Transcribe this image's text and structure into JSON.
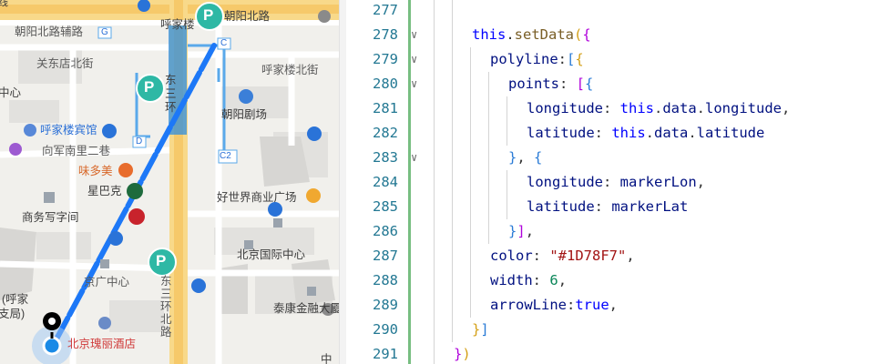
{
  "map": {
    "labels": {
      "chaoyang_north_rd_top": "朝阳北路",
      "huhudajie_short": "呼家楼",
      "road_top_left": "线",
      "chaoyang_north_aux": "朝阳北路辅路",
      "guandongdian_north": "关东店北街",
      "zhong": "中心",
      "hujialou_north_st": "呼家楼北街",
      "east_third_ring_a": "东",
      "east_third_ring_b": "三",
      "east_third_ring_c": "环",
      "chaoyang_theater": "朝阳剧场",
      "hujialou_hotel": "呼家楼宾馆",
      "xiangjun_south": "向军南里二巷",
      "weiduomei": "味多美",
      "starbucks": "星巴克",
      "shangwu": "商务写字间",
      "haoshijie": "好世界商业广场",
      "beijing_intl_center": "北京国际中心",
      "jingguang_center": "京广中心",
      "taikang": "泰康金融大厦",
      "hujia_branch_a": "(呼家",
      "hujia_branch_b": "支局)",
      "beijing_guili": "北京瑰丽酒店",
      "east3rd_north_a": "东",
      "east3rd_north_b": "三",
      "east3rd_north_c": "环",
      "east3rd_north_d": "北",
      "east3rd_north_e": "路",
      "exit_c": "C",
      "exit_c2": "C2",
      "exit_d": "D",
      "exit_g": "G",
      "parking": "P",
      "zhong_bottom": "中"
    },
    "route_color": "#1D78F7"
  },
  "editor": {
    "lines": [
      {
        "num": "277",
        "fold": "",
        "indent": 2,
        "tokens": []
      },
      {
        "num": "278",
        "fold": "∨",
        "indent": 2,
        "tokens": [
          {
            "t": "this",
            "c": "k-this"
          },
          {
            "t": ".",
            "c": "k-pun"
          },
          {
            "t": "setData",
            "c": "k-fn"
          },
          {
            "t": "(",
            "c": "k-b1"
          },
          {
            "t": "{",
            "c": "k-b2"
          }
        ]
      },
      {
        "num": "279",
        "fold": "∨",
        "indent": 3,
        "tokens": [
          {
            "t": "polyline",
            "c": "k-var"
          },
          {
            "t": ":",
            "c": "k-pun"
          },
          {
            "t": "[",
            "c": "k-b3"
          },
          {
            "t": "{",
            "c": "k-b1"
          }
        ]
      },
      {
        "num": "280",
        "fold": "∨",
        "indent": 4,
        "tokens": [
          {
            "t": "points",
            "c": "k-var"
          },
          {
            "t": ": ",
            "c": "k-pun"
          },
          {
            "t": "[",
            "c": "k-b2"
          },
          {
            "t": "{",
            "c": "k-b3"
          }
        ]
      },
      {
        "num": "281",
        "fold": "",
        "indent": 5,
        "tokens": [
          {
            "t": "longitude",
            "c": "k-var"
          },
          {
            "t": ": ",
            "c": "k-pun"
          },
          {
            "t": "this",
            "c": "k-this"
          },
          {
            "t": ".",
            "c": "k-pun"
          },
          {
            "t": "data",
            "c": "k-var"
          },
          {
            "t": ".",
            "c": "k-pun"
          },
          {
            "t": "longitude",
            "c": "k-var"
          },
          {
            "t": ",",
            "c": "k-pun"
          }
        ]
      },
      {
        "num": "282",
        "fold": "",
        "indent": 5,
        "tokens": [
          {
            "t": "latitude",
            "c": "k-var"
          },
          {
            "t": ": ",
            "c": "k-pun"
          },
          {
            "t": "this",
            "c": "k-this"
          },
          {
            "t": ".",
            "c": "k-pun"
          },
          {
            "t": "data",
            "c": "k-var"
          },
          {
            "t": ".",
            "c": "k-pun"
          },
          {
            "t": "latitude",
            "c": "k-var"
          }
        ]
      },
      {
        "num": "283",
        "fold": "∨",
        "indent": 4,
        "tokens": [
          {
            "t": "}",
            "c": "k-b3"
          },
          {
            "t": ", ",
            "c": "k-pun"
          },
          {
            "t": "{",
            "c": "k-b3"
          }
        ]
      },
      {
        "num": "284",
        "fold": "",
        "indent": 5,
        "tokens": [
          {
            "t": "longitude",
            "c": "k-var"
          },
          {
            "t": ": ",
            "c": "k-pun"
          },
          {
            "t": "markerLon",
            "c": "k-var"
          },
          {
            "t": ",",
            "c": "k-pun"
          }
        ]
      },
      {
        "num": "285",
        "fold": "",
        "indent": 5,
        "tokens": [
          {
            "t": "latitude",
            "c": "k-var"
          },
          {
            "t": ": ",
            "c": "k-pun"
          },
          {
            "t": "markerLat",
            "c": "k-var"
          }
        ]
      },
      {
        "num": "286",
        "fold": "",
        "indent": 4,
        "tokens": [
          {
            "t": "}",
            "c": "k-b3"
          },
          {
            "t": "]",
            "c": "k-b2"
          },
          {
            "t": ",",
            "c": "k-pun"
          }
        ]
      },
      {
        "num": "287",
        "fold": "",
        "indent": 3,
        "tokens": [
          {
            "t": "color",
            "c": "k-var"
          },
          {
            "t": ": ",
            "c": "k-pun"
          },
          {
            "t": "\"#1D78F7\"",
            "c": "k-str"
          },
          {
            "t": ",",
            "c": "k-pun"
          }
        ]
      },
      {
        "num": "288",
        "fold": "",
        "indent": 3,
        "tokens": [
          {
            "t": "width",
            "c": "k-var"
          },
          {
            "t": ": ",
            "c": "k-pun"
          },
          {
            "t": "6",
            "c": "k-num"
          },
          {
            "t": ",",
            "c": "k-pun"
          }
        ]
      },
      {
        "num": "289",
        "fold": "",
        "indent": 3,
        "tokens": [
          {
            "t": "arrowLine",
            "c": "k-var"
          },
          {
            "t": ":",
            "c": "k-pun"
          },
          {
            "t": "true",
            "c": "k-bool"
          },
          {
            "t": ",",
            "c": "k-pun"
          }
        ]
      },
      {
        "num": "290",
        "fold": "",
        "indent": 2,
        "tokens": [
          {
            "t": "}",
            "c": "k-b1"
          },
          {
            "t": "]",
            "c": "k-b3"
          }
        ]
      },
      {
        "num": "291",
        "fold": "",
        "indent": 1,
        "tokens": [
          {
            "t": "}",
            "c": "k-b2"
          },
          {
            "t": ")",
            "c": "k-b1"
          }
        ]
      }
    ]
  }
}
